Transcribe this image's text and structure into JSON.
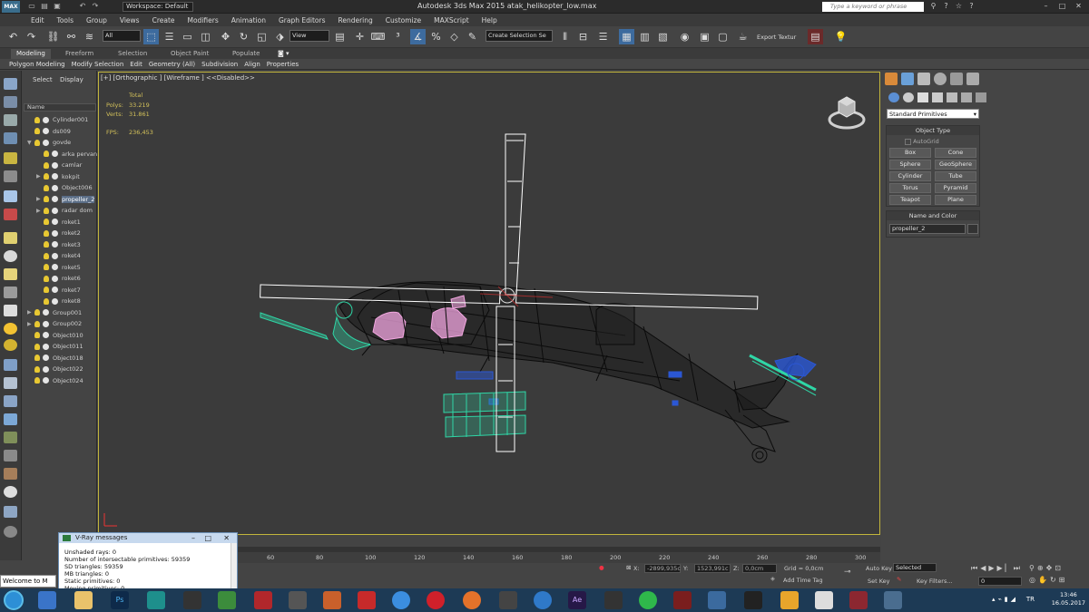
{
  "app": {
    "title": "Autodesk 3ds Max 2015    atak_helikopter_low.max",
    "logo": "MAX",
    "workspace": "Workspace: Default",
    "search_placeholder": "Type a keyword or phrase"
  },
  "menu": [
    "Edit",
    "Tools",
    "Group",
    "Views",
    "Create",
    "Modifiers",
    "Animation",
    "Graph Editors",
    "Rendering",
    "Customize",
    "MAXScript",
    "Help"
  ],
  "toolbar": {
    "selection_filter": "All",
    "ref_coord": "View",
    "named_selection": "Create Selection Se",
    "export_label": "Export Textur"
  },
  "ribbon": {
    "tabs": [
      "Modeling",
      "Freeform",
      "Selection",
      "Object Paint",
      "Populate"
    ],
    "sub": [
      "Polygon Modeling",
      "Modify Selection",
      "Edit",
      "Geometry (All)",
      "Subdivision",
      "Align",
      "Properties"
    ]
  },
  "explorer": {
    "tabs": [
      "Select",
      "Display"
    ],
    "column": "Name",
    "items": [
      {
        "label": "Cylinder001",
        "indent": 0,
        "arrow": ""
      },
      {
        "label": "ds009",
        "indent": 0,
        "arrow": ""
      },
      {
        "label": "govde",
        "indent": 0,
        "arrow": "▼"
      },
      {
        "label": "arka pervan",
        "indent": 1,
        "arrow": ""
      },
      {
        "label": "camlar",
        "indent": 1,
        "arrow": ""
      },
      {
        "label": "kokpit",
        "indent": 1,
        "arrow": "▶"
      },
      {
        "label": "Object006",
        "indent": 1,
        "arrow": ""
      },
      {
        "label": "propeller_2",
        "indent": 1,
        "arrow": "▶",
        "selected": true
      },
      {
        "label": "radar dom",
        "indent": 1,
        "arrow": "▶"
      },
      {
        "label": "roket1",
        "indent": 1,
        "arrow": ""
      },
      {
        "label": "roket2",
        "indent": 1,
        "arrow": ""
      },
      {
        "label": "roket3",
        "indent": 1,
        "arrow": ""
      },
      {
        "label": "roket4",
        "indent": 1,
        "arrow": ""
      },
      {
        "label": "roket5",
        "indent": 1,
        "arrow": ""
      },
      {
        "label": "roket6",
        "indent": 1,
        "arrow": ""
      },
      {
        "label": "roket7",
        "indent": 1,
        "arrow": ""
      },
      {
        "label": "roket8",
        "indent": 1,
        "arrow": ""
      },
      {
        "label": "Group001",
        "indent": 0,
        "arrow": "▶"
      },
      {
        "label": "Group002",
        "indent": 0,
        "arrow": "▶"
      },
      {
        "label": "Object010",
        "indent": 0,
        "arrow": ""
      },
      {
        "label": "Object011",
        "indent": 0,
        "arrow": ""
      },
      {
        "label": "Object018",
        "indent": 0,
        "arrow": ""
      },
      {
        "label": "Object022",
        "indent": 0,
        "arrow": ""
      },
      {
        "label": "Object024",
        "indent": 0,
        "arrow": ""
      }
    ]
  },
  "viewport": {
    "label": "[+] [Orthographic ] [Wireframe ]  <<Disabled>>",
    "stats": {
      "total": "Total",
      "polys_label": "Polys:",
      "polys": "33.219",
      "verts_label": "Verts:",
      "verts": "31.861",
      "fps_label": "FPS:",
      "fps": "236,453"
    }
  },
  "command_panel": {
    "category": "Standard Primitives",
    "object_type_title": "Object Type",
    "autogrid": "AutoGrid",
    "buttons": [
      "Box",
      "Cone",
      "Sphere",
      "GeoSphere",
      "Cylinder",
      "Tube",
      "Torus",
      "Pyramid",
      "Teapot",
      "Plane"
    ],
    "name_color_title": "Name and Color",
    "object_name": "propeller_2"
  },
  "vray": {
    "title": "V-Ray messages",
    "lines": [
      "Unshaded rays: 0",
      "Number of intersectable primitives: 59359",
      "SD triangles: 59359",
      "MB triangles: 0",
      "Static primitives: 0",
      "Moving primitives: 0"
    ]
  },
  "timeline": {
    "ticks": [
      "60",
      "80",
      "100",
      "120",
      "140",
      "160",
      "180",
      "200",
      "220",
      "240",
      "260",
      "280",
      "300"
    ]
  },
  "status": {
    "x_label": "X:",
    "x": "-2899,935c",
    "y_label": "Y:",
    "y": "1523,991c",
    "z_label": "Z:",
    "z": "0,0cm",
    "grid": "Grid = 0,0cm",
    "add_time_tag": "Add Time Tag",
    "auto_key": "Auto Key",
    "set_key": "Set Key",
    "key_mode": "Selected",
    "key_filters": "Key Filters...",
    "frame": "0",
    "maxscript": "Welcome to M"
  },
  "taskbar": {
    "lang": "TR",
    "time": "13:46",
    "date": "16.05.2017"
  },
  "colors": {
    "viewport_border": "#c2b53c",
    "wire_white": "#ffffff",
    "wire_dark": "#0b0b0b",
    "wire_teal": "#2fd6a6",
    "wire_pink": "#f2a6e0",
    "wire_blue": "#2b57d4"
  }
}
